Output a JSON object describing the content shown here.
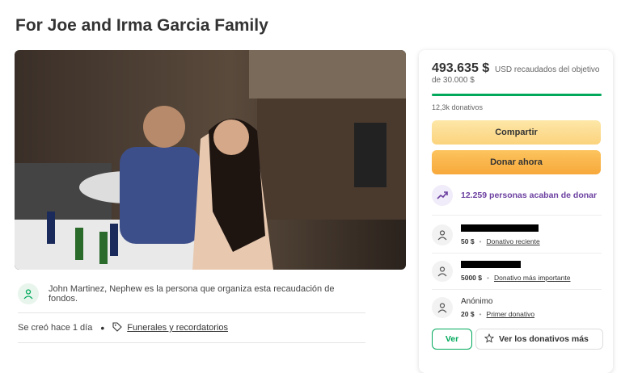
{
  "campaign": {
    "title": "For Joe and Irma Garcia Family"
  },
  "photo": {
    "description_icon": "family-photo"
  },
  "organizer": {
    "text": "John Martinez, Nephew es la persona que organiza esta recaudación de fondos."
  },
  "meta": {
    "created": "Se creó hace 1 día",
    "category": "Funerales y recordatorios"
  },
  "fundraiser": {
    "amount": "493.635 $",
    "goal_text": "USD recaudados del objetivo de 30.000 $",
    "progress_fraction": 1,
    "donations_count": "12,3k donativos",
    "share_label": "Compartir",
    "donate_label": "Donar ahora",
    "recent_donors_text": "12.259 personas acaban de donar",
    "donors": [
      {
        "name": "",
        "amount": "50 $",
        "tag": "Donativo reciente",
        "name_redacted": true
      },
      {
        "name": "",
        "amount": "5000 $",
        "tag": "Donativo más importante",
        "name_redacted": true
      },
      {
        "name": "Anónimo",
        "amount": "20 $",
        "tag": "Primer donativo",
        "name_redacted": false
      }
    ],
    "see_label": "Ver",
    "top_donations_label": "Ver los donativos más"
  },
  "colors": {
    "brand_green": "#02a95c",
    "share_yellow": "#fbd37d",
    "donate_orange": "#f7a83a",
    "trend_purple": "#6b3fa0"
  }
}
